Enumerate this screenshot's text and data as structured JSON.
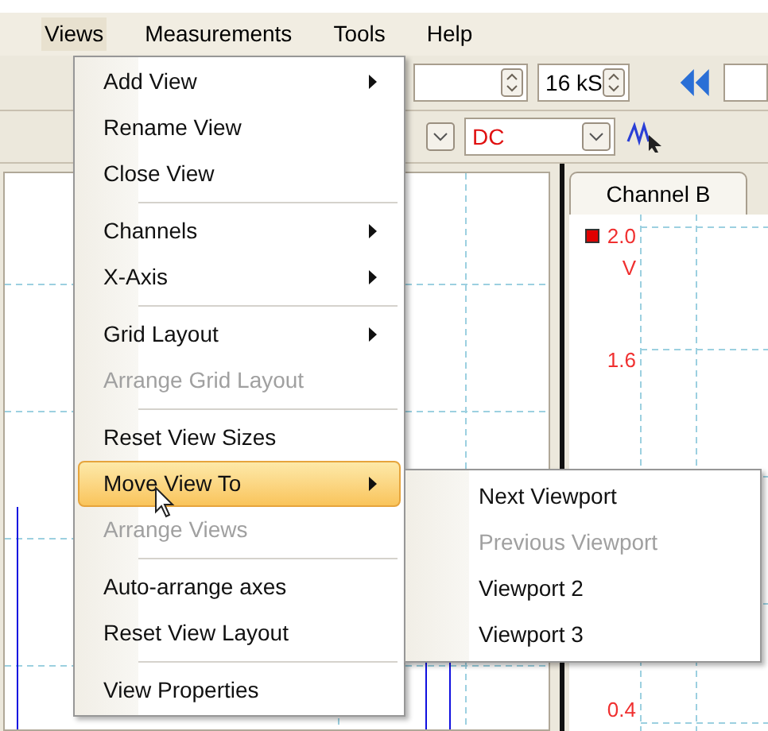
{
  "menu_bar": [
    {
      "label": "Views",
      "selected": true
    },
    {
      "label": "Measurements",
      "selected": false
    },
    {
      "label": "Tools",
      "selected": false
    },
    {
      "label": "Help",
      "selected": false
    }
  ],
  "toolbar": {
    "samples": "16 kS",
    "coupling": "DC"
  },
  "view_tab": {
    "label": "Channel B"
  },
  "axis_labels": [
    {
      "text": "2.0",
      "unit": "V"
    },
    {
      "text": "1.6"
    },
    {
      "text": "0.4"
    }
  ],
  "views_menu": [
    {
      "kind": "item",
      "label": "Add View",
      "submenu": true,
      "disabled": false,
      "selected": false
    },
    {
      "kind": "item",
      "label": "Rename View",
      "submenu": false,
      "disabled": false,
      "selected": false
    },
    {
      "kind": "item",
      "label": "Close View",
      "submenu": false,
      "disabled": false,
      "selected": false
    },
    {
      "kind": "separator"
    },
    {
      "kind": "item",
      "label": "Channels",
      "submenu": true,
      "disabled": false,
      "selected": false
    },
    {
      "kind": "item",
      "label": "X-Axis",
      "submenu": true,
      "disabled": false,
      "selected": false
    },
    {
      "kind": "separator"
    },
    {
      "kind": "item",
      "label": "Grid Layout",
      "submenu": true,
      "disabled": false,
      "selected": false
    },
    {
      "kind": "item",
      "label": "Arrange Grid Layout",
      "submenu": false,
      "disabled": true,
      "selected": false
    },
    {
      "kind": "separator"
    },
    {
      "kind": "item",
      "label": "Reset View Sizes",
      "submenu": false,
      "disabled": false,
      "selected": false
    },
    {
      "kind": "item",
      "label": "Move View To",
      "submenu": true,
      "disabled": false,
      "selected": true
    },
    {
      "kind": "item",
      "label": "Arrange Views",
      "submenu": false,
      "disabled": true,
      "selected": false
    },
    {
      "kind": "separator"
    },
    {
      "kind": "item",
      "label": "Auto-arrange axes",
      "submenu": false,
      "disabled": false,
      "selected": false
    },
    {
      "kind": "item",
      "label": "Reset View Layout",
      "submenu": false,
      "disabled": false,
      "selected": false
    },
    {
      "kind": "separator"
    },
    {
      "kind": "item",
      "label": "View Properties",
      "submenu": false,
      "disabled": false,
      "selected": false
    }
  ],
  "move_view_submenu": [
    {
      "label": "Next Viewport",
      "disabled": false
    },
    {
      "label": "Previous Viewport",
      "disabled": true
    },
    {
      "label": "Viewport 2",
      "disabled": false
    },
    {
      "label": "Viewport 3",
      "disabled": false
    }
  ]
}
